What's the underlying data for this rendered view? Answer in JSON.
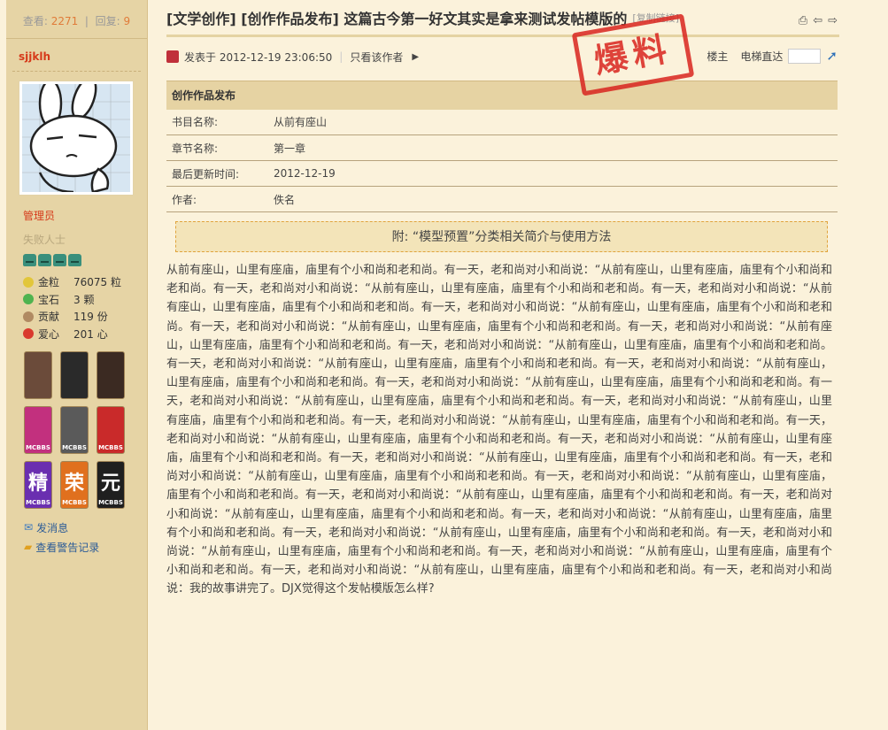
{
  "stats": {
    "view_label": "查看:",
    "views": "2271",
    "reply_label": "回复:",
    "replies": "9"
  },
  "author": {
    "name": "sjjklh",
    "group": "管理员",
    "title": "失败人士",
    "props": [
      {
        "label": "金粒",
        "value": "76075 粒",
        "color": "#e2c63a"
      },
      {
        "label": "宝石",
        "value": "3 颗",
        "color": "#4fb34f"
      },
      {
        "label": "贡献",
        "value": "119 份",
        "color": "#b08a62"
      },
      {
        "label": "爱心",
        "value": "201 心",
        "color": "#d93a2e"
      }
    ],
    "medals": [
      {
        "glyph": "",
        "badge": "",
        "color": "#6b4b3a"
      },
      {
        "glyph": "",
        "badge": "",
        "color": "#2a2a2a"
      },
      {
        "glyph": "",
        "badge": "",
        "color": "#3b2a22"
      },
      {
        "glyph": "",
        "badge": "MCBBS",
        "color": "#c2307e"
      },
      {
        "glyph": "",
        "badge": "MCBBS",
        "color": "#5a5a5a"
      },
      {
        "glyph": "",
        "badge": "MCBBS",
        "color": "#c92a2a"
      },
      {
        "glyph": "精",
        "badge": "MCBBS",
        "color": "#6a2fb0"
      },
      {
        "glyph": "荣",
        "badge": "MCBBS",
        "color": "#e0701e"
      },
      {
        "glyph": "元",
        "badge": "MCBBS",
        "color": "#1f1f1f"
      }
    ],
    "links": [
      {
        "icon": "✉",
        "label": "发消息"
      },
      {
        "icon": "▰",
        "label": "查看警告记录"
      }
    ]
  },
  "post": {
    "title": "[文学创作] [创作作品发布] 这篇古今第一好文其实是拿来测试发帖模版的",
    "copy_link": "[复制链接]",
    "posted_at": "发表于 2012-12-19 23:06:50",
    "only_author": "只看该作者",
    "floor": "楼主",
    "jump_label": "电梯直达",
    "stamp": "爆料",
    "table_title": "创作作品发布",
    "rows": [
      {
        "k": "书目名称:",
        "v": "从前有座山"
      },
      {
        "k": "章节名称:",
        "v": "第一章"
      },
      {
        "k": "最后更新时间:",
        "v": "2012-12-19"
      },
      {
        "k": "作者:",
        "v": "佚名"
      }
    ],
    "notice": "附: “模型预置”分类相关简介与使用方法",
    "body": "从前有座山，山里有座庙，庙里有个小和尚和老和尚。有一天，老和尚对小和尚说：“从前有座山，山里有座庙，庙里有个小和尚和老和尚。有一天，老和尚对小和尚说：“从前有座山，山里有座庙，庙里有个小和尚和老和尚。有一天，老和尚对小和尚说：“从前有座山，山里有座庙，庙里有个小和尚和老和尚。有一天，老和尚对小和尚说：“从前有座山，山里有座庙，庙里有个小和尚和老和尚。有一天，老和尚对小和尚说：“从前有座山，山里有座庙，庙里有个小和尚和老和尚。有一天，老和尚对小和尚说：“从前有座山，山里有座庙，庙里有个小和尚和老和尚。有一天，老和尚对小和尚说：“从前有座山，山里有座庙，庙里有个小和尚和老和尚。有一天，老和尚对小和尚说：“从前有座山，山里有座庙，庙里有个小和尚和老和尚。有一天，老和尚对小和尚说：“从前有座山，山里有座庙，庙里有个小和尚和老和尚。有一天，老和尚对小和尚说：“从前有座山，山里有座庙，庙里有个小和尚和老和尚。有一天，老和尚对小和尚说：“从前有座山，山里有座庙，庙里有个小和尚和老和尚。有一天，老和尚对小和尚说：“从前有座山，山里有座庙，庙里有个小和尚和老和尚。有一天，老和尚对小和尚说：“从前有座山，山里有座庙，庙里有个小和尚和老和尚。有一天，老和尚对小和尚说：“从前有座山，山里有座庙，庙里有个小和尚和老和尚。有一天，老和尚对小和尚说：“从前有座山，山里有座庙，庙里有个小和尚和老和尚。有一天，老和尚对小和尚说：“从前有座山，山里有座庙，庙里有个小和尚和老和尚。有一天，老和尚对小和尚说：“从前有座山，山里有座庙，庙里有个小和尚和老和尚。有一天，老和尚对小和尚说：“从前有座山，山里有座庙，庙里有个小和尚和老和尚。有一天，老和尚对小和尚说：“从前有座山，山里有座庙，庙里有个小和尚和老和尚。有一天，老和尚对小和尚说：“从前有座山，山里有座庙，庙里有个小和尚和老和尚。有一天，老和尚对小和尚说：“从前有座山，山里有座庙，庙里有个小和尚和老和尚。有一天，老和尚对小和尚说：“从前有座山，山里有座庙，庙里有个小和尚和老和尚。有一天，老和尚对小和尚说：“从前有座山，山里有座庙，庙里有个小和尚和老和尚。有一天，老和尚对小和尚说：“从前有座山，山里有座庙，庙里有个小和尚和老和尚。有一天，老和尚对小和尚说：“从前有座山，山里有座庙，庙里有个小和尚和老和尚。有一天，老和尚对小和尚说：我的故事讲完了。DJX觉得这个发帖模版怎么样?"
  }
}
